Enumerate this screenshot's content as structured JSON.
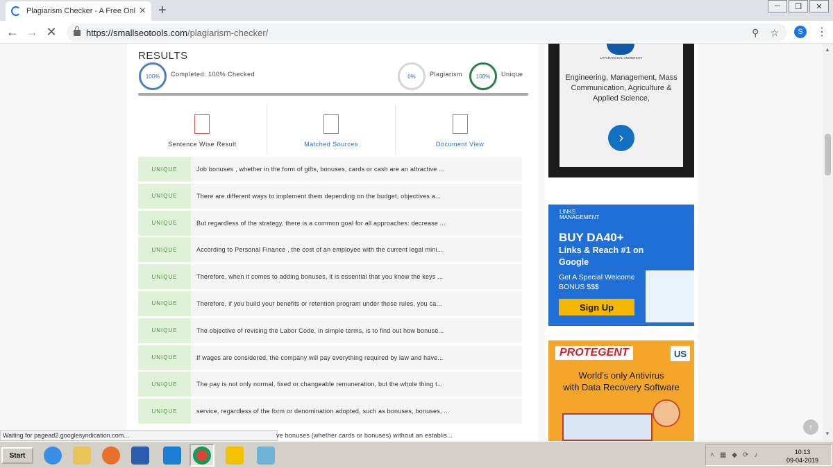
{
  "browser": {
    "tab_title": "Plagiarism Checker - A Free Online Pl",
    "url_host": "https://smallseotools.com",
    "url_path": "/plagiarism-checker/",
    "profile_initial": "S"
  },
  "results": {
    "title": "RESULTS",
    "completed_pct": "100%",
    "completed_label": "Completed: 100% Checked",
    "plagiarism_pct": "0%",
    "plagiarism_label": "Plagiarism",
    "unique_pct": "100%",
    "unique_label": "Unique",
    "progress": 1.0
  },
  "view_tabs": [
    {
      "label": "Sentence Wise Result",
      "icon": "sentence-doc-icon"
    },
    {
      "label": "Matched Sources",
      "icon": "matched-doc-icon"
    },
    {
      "label": "Document View",
      "icon": "search-doc-icon"
    }
  ],
  "sentences": [
    {
      "status": "UNIQUE",
      "text": "Job bonuses , whether in the form of gifts, bonuses, cards or cash are an attractive ..."
    },
    {
      "status": "UNIQUE",
      "text": "There are different ways to implement them depending on the budget, objectives a..."
    },
    {
      "status": "UNIQUE",
      "text": "But regardless of the strategy, there is a common goal for all approaches: decrease ..."
    },
    {
      "status": "UNIQUE",
      "text": "According to Personal Finance , the cost of an employee with the current legal mini..."
    },
    {
      "status": "UNIQUE",
      "text": "Therefore, when it comes to adding bonuses, it is essential that you know the keys ..."
    },
    {
      "status": "UNIQUE",
      "text": "Therefore, if you build your benefits or retention program under those rules, you ca..."
    },
    {
      "status": "UNIQUE",
      "text": "The objective of revising the Labor Code, in simple terms, is to find out how bonuse..."
    },
    {
      "status": "UNIQUE",
      "text": "If wages are considered, the company will pay everything required by law and have..."
    },
    {
      "status": "UNIQUE",
      "text": "The pay is not only normal, fixed or changeable remuneration, but the whole thing t..."
    },
    {
      "status": "UNIQUE",
      "text": "service, regardless of the form or denomination adopted, such as bonuses, bonuses, ..."
    }
  ],
  "peek_text": "ve bonuses (whether cards or bonuses) without an establis...",
  "ads": {
    "ad1_logo": "UTTARANCHAL UNIVERSITY",
    "ad1_text": "Engineering, Management, Mass Communication, Agriculture & Applied Science,",
    "ad2_logo_line1": "LINKS",
    "ad2_logo_line2": "MANAGEMENT",
    "ad2_head": "BUY DA40+",
    "ad2_sub": "Links & Reach #1 on Google",
    "ad2_small": "Get A Special Welcome BONUS $$$",
    "ad2_btn": "Sign Up",
    "ad3_brand": "PROTEGENT",
    "ad3_us": "US",
    "ad3_line1": "World's only Antivirus",
    "ad3_line2": "with Data Recovery Software"
  },
  "status_text": "Waiting for pagead2.googlesyndication.com...",
  "taskbar": {
    "start": "Start",
    "time": "10:13",
    "date": "09-04-2019"
  },
  "colors": {
    "unique_badge_bg": "#dff2d8",
    "unique_badge_text": "#4e8a3a",
    "link_blue": "#2a6db5"
  }
}
